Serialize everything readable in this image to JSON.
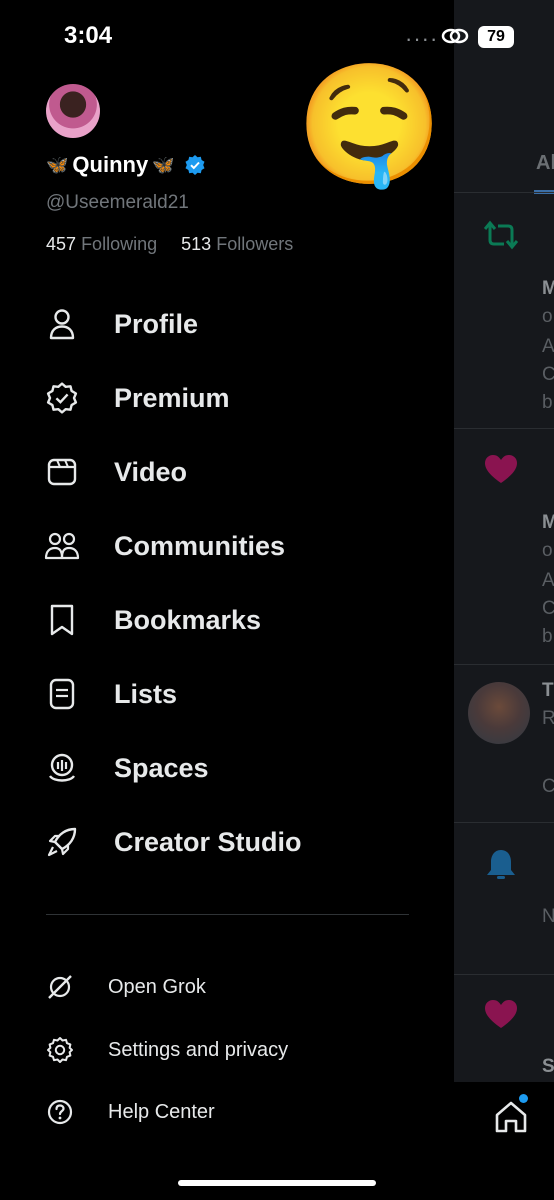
{
  "status_bar": {
    "time": "3:04",
    "battery": "79"
  },
  "profile": {
    "name": "Quinny",
    "handle": "@Useemerald21",
    "following_count": "457",
    "following_label": "Following",
    "followers_count": "513",
    "followers_label": "Followers",
    "emoji": "🤤"
  },
  "nav": [
    {
      "label": "Profile",
      "icon": "person-icon"
    },
    {
      "label": "Premium",
      "icon": "premium-badge-icon"
    },
    {
      "label": "Video",
      "icon": "video-icon"
    },
    {
      "label": "Communities",
      "icon": "communities-icon"
    },
    {
      "label": "Bookmarks",
      "icon": "bookmark-icon"
    },
    {
      "label": "Lists",
      "icon": "lists-icon"
    },
    {
      "label": "Spaces",
      "icon": "spaces-icon"
    },
    {
      "label": "Creator Studio",
      "icon": "rocket-icon"
    }
  ],
  "secondary": [
    {
      "label": "Open Grok",
      "icon": "grok-icon"
    },
    {
      "label": "Settings and privacy",
      "icon": "gear-icon"
    },
    {
      "label": "Help Center",
      "icon": "help-icon"
    }
  ],
  "feed": {
    "tab_partial": "Al",
    "letters": [
      "M",
      "o",
      "A",
      "C",
      "b",
      "M",
      "o",
      "A",
      "C",
      "b",
      "T",
      "R",
      "C",
      "N",
      "S"
    ]
  },
  "colors": {
    "accent": "#1d9bf0",
    "retweet": "#00ba7c",
    "like": "#f91880"
  }
}
